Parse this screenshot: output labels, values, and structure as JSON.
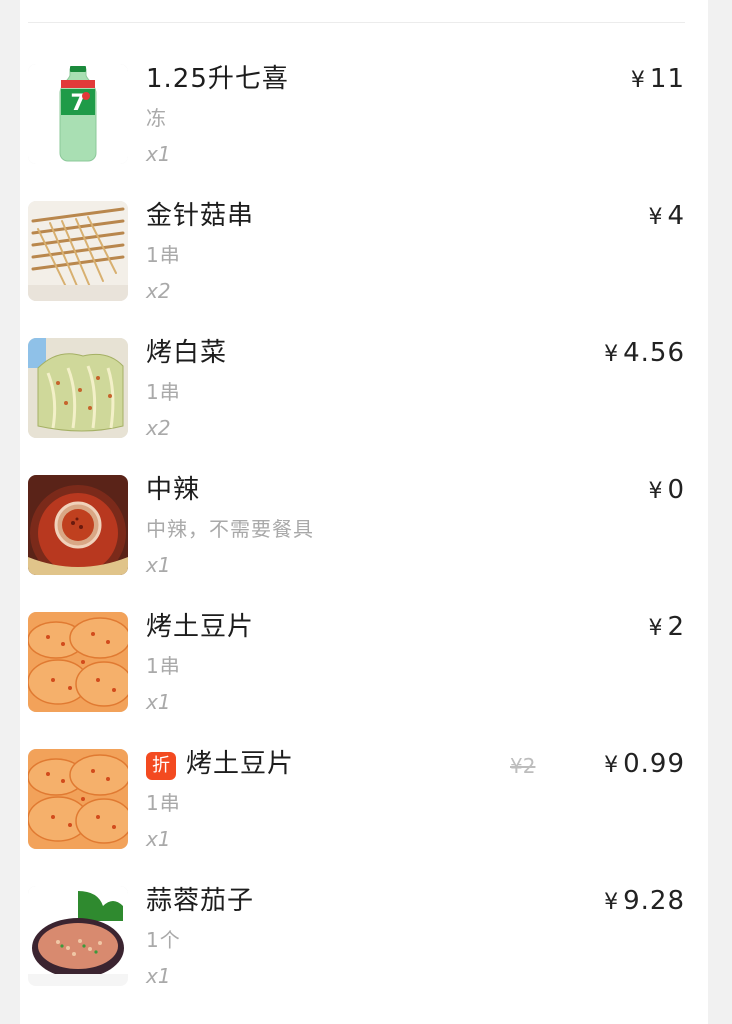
{
  "items": [
    {
      "name": "1.25升七喜",
      "spec": "冻",
      "qty": "x1",
      "price": "11",
      "currency": "¥",
      "image_icon": "7up-bottle-image"
    },
    {
      "name": "金针菇串",
      "spec": "1串",
      "qty": "x2",
      "price": "4",
      "currency": "¥",
      "image_icon": "enoki-skewer-image"
    },
    {
      "name": "烤白菜",
      "spec": "1串",
      "qty": "x2",
      "price": "4.56",
      "currency": "¥",
      "image_icon": "grilled-cabbage-image"
    },
    {
      "name": "中辣",
      "spec": "中辣，不需要餐具",
      "qty": "x1",
      "price": "0",
      "currency": "¥",
      "image_icon": "hotpot-spicy-image"
    },
    {
      "name": "烤土豆片",
      "spec": "1串",
      "qty": "x1",
      "price": "2",
      "currency": "¥",
      "image_icon": "grilled-potato-image"
    },
    {
      "name": "烤土豆片",
      "badge": "折",
      "old_price": "¥2",
      "spec": "1串",
      "qty": "x1",
      "price": "0.99",
      "currency": "¥",
      "image_icon": "grilled-potato-image"
    },
    {
      "name": "蒜蓉茄子",
      "spec": "1个",
      "qty": "x1",
      "price": "9.28",
      "currency": "¥",
      "image_icon": "garlic-eggplant-image"
    }
  ],
  "colors": {
    "badge": "#f34a20",
    "muted_text": "#a9a9a9",
    "strike_price": "#bdbdbd"
  }
}
